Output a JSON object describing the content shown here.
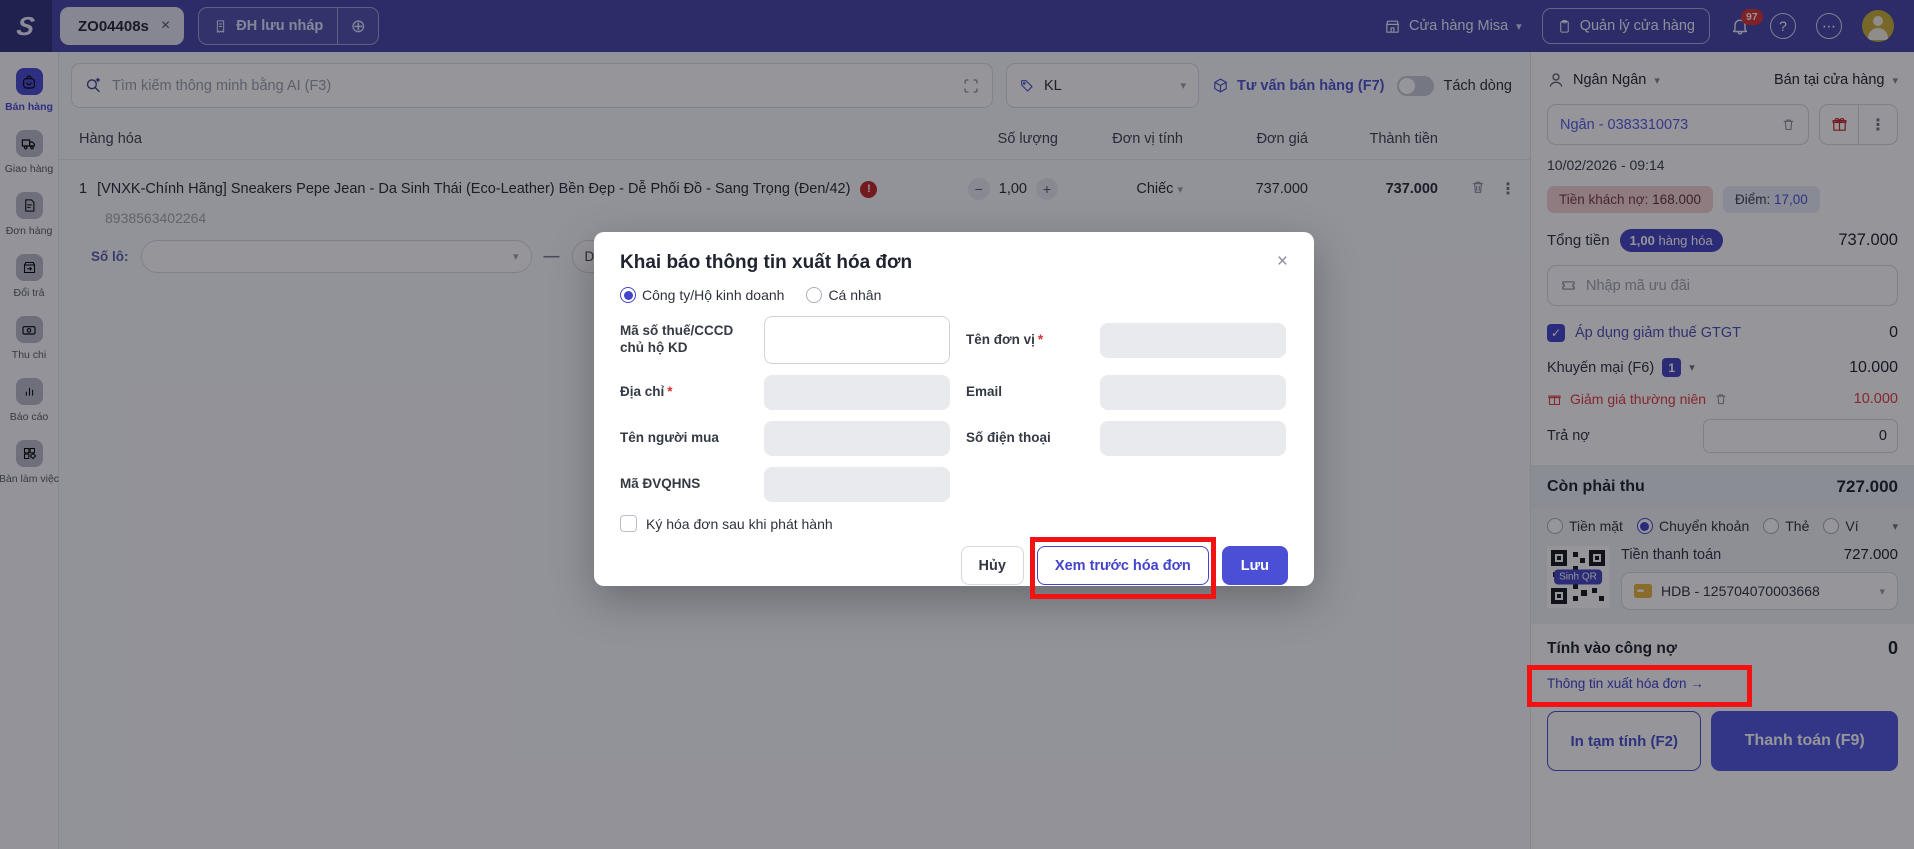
{
  "topbar": {
    "tab_label": "ZO04408s",
    "draft_button": "ĐH lưu nháp",
    "store_name": "Cửa hàng Misa",
    "manage_store": "Quản lý cửa hàng",
    "notification_count": "97"
  },
  "sidebar": {
    "items": [
      {
        "label": "Bán hàng",
        "icon": "bag-icon",
        "active": true
      },
      {
        "label": "Giao hàng",
        "icon": "truck-icon",
        "active": false
      },
      {
        "label": "Đơn hàng",
        "icon": "receipt-icon",
        "active": false
      },
      {
        "label": "Đổi trả",
        "icon": "return-box-icon",
        "active": false
      },
      {
        "label": "Thu chi",
        "icon": "money-icon",
        "active": false
      },
      {
        "label": "Báo cáo",
        "icon": "chart-icon",
        "active": false
      },
      {
        "label": "Bàn làm việc",
        "icon": "grid-icon",
        "active": false
      }
    ]
  },
  "toolbar": {
    "search_placeholder": "Tìm kiếm thông minh bằng AI (F3)",
    "unit_filter_value": "KL",
    "consult_label": "Tư vấn bán hàng (F7)",
    "split_line_label": "Tách dòng"
  },
  "table": {
    "headers": {
      "product": "Hàng hóa",
      "qty": "Số lượng",
      "unit": "Đơn vị tính",
      "price": "Đơn giá",
      "amount": "Thành tiền"
    },
    "rows": [
      {
        "index": "1",
        "name": "[VNXK-Chính Hãng] Sneakers Pepe Jean - Da Sinh Thái (Eco-Leather) Bền Đẹp - Dễ Phối Đồ - Sang Trọng (Đen/42)",
        "barcode": "8938563402264",
        "qty": "1,00",
        "unit": "Chiếc",
        "price": "737.000",
        "amount": "737.000",
        "lot_label": "Số lô:",
        "lot_extra": "D"
      }
    ]
  },
  "modal": {
    "title": "Khai báo thông tin xuất hóa đơn",
    "radio_company": "Công ty/Hộ kinh doanh",
    "radio_personal": "Cá nhân",
    "fields": {
      "tax_label": "Mã số thuế/CCCD chủ hộ KD",
      "unit_name_label": "Tên đơn vị",
      "address_label": "Địa chỉ",
      "email_label": "Email",
      "buyer_label": "Tên người mua",
      "phone_label": "Số điện thoại",
      "budget_code_label": "Mã ĐVQHNS"
    },
    "required_mark": "*",
    "sign_checkbox_label": "Ký hóa đơn sau khi phát hành",
    "buttons": {
      "cancel": "Hủy",
      "preview": "Xem trước hóa đơn",
      "save": "Lưu"
    }
  },
  "panel": {
    "customer_name": "Ngân Ngân",
    "sale_channel": "Bán tại cửa hàng",
    "customer_phone": "Ngân - 0383310073",
    "datetime": "10/02/2026 - 09:14",
    "debt_label": "Tiền khách nợ:",
    "debt_value": "168.000",
    "points_label": "Điểm:",
    "points_value": "17,00",
    "total_label": "Tổng tiền",
    "total_badge_qty": "1,00",
    "total_badge_text": "hàng hóa",
    "total_value": "737.000",
    "promo_placeholder": "Nhập mã ưu đãi",
    "vat_label": "Áp dụng giảm thuế GTGT",
    "vat_value": "0",
    "promotion_label": "Khuyến mại (F6)",
    "promotion_count": "1",
    "promotion_value": "10.000",
    "discount_label": "Giảm giá thường niên",
    "discount_value": "10.000",
    "repay_label": "Trả nợ",
    "repay_value": "0",
    "due_label": "Còn phải thu",
    "due_value": "727.000",
    "payments": [
      "Tiền mặt",
      "Chuyển khoản",
      "Thẻ",
      "Ví"
    ],
    "selected_payment": "Chuyển khoản",
    "qr_button_label": "Sinh QR",
    "pay_amount_label": "Tiền thanh toán",
    "pay_amount_value": "727.000",
    "bank_account": "HDB - 125704070003668",
    "charge_debt_label": "Tính vào công nợ",
    "charge_debt_value": "0",
    "invoice_link": "Thông tin xuất hóa đơn →",
    "print_button": "In tạm tính (F2)",
    "pay_button": "Thanh toán (F9)"
  },
  "icons": {
    "close": "×",
    "chevron": "▾",
    "kebab": "⋮",
    "ellipsis": "⋯",
    "help": "?",
    "plus_circle": "⊕",
    "minus": "−",
    "plus": "+",
    "dash": "—",
    "check": "✓",
    "alert": "!",
    "logo": "S"
  },
  "colors": {
    "primary": "#4343cc",
    "topbar": "#4444a6",
    "danger": "#e23c3c",
    "annotation": "#f31212",
    "badge_debt_bg": "#f3d3d3",
    "badge_points_bg": "#e8ecf7"
  }
}
